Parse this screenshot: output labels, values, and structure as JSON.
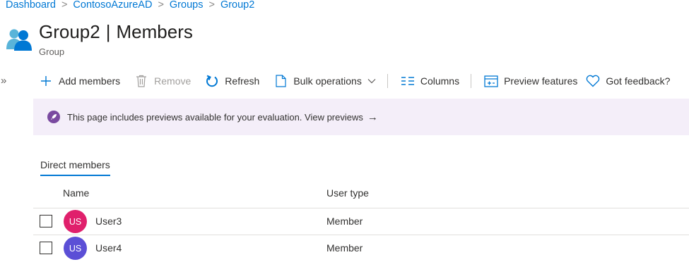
{
  "breadcrumb": [
    "Dashboard",
    "ContosoAzureAD",
    "Groups",
    "Group2"
  ],
  "header": {
    "name": "Group2",
    "section": "Members",
    "subtitle": "Group"
  },
  "collapse_glyph": "»",
  "toolbar": {
    "add": "Add members",
    "remove": "Remove",
    "refresh": "Refresh",
    "bulk": "Bulk operations",
    "columns": "Columns",
    "preview": "Preview features",
    "feedback": "Got feedback?"
  },
  "banner": {
    "text": "This page includes previews available for your evaluation. View previews",
    "arrow": "→"
  },
  "tab": "Direct members",
  "table": {
    "headers": [
      "Name",
      "User type"
    ],
    "rows": [
      {
        "initials": "US",
        "name": "User3",
        "type": "Member",
        "avatar_color": "#e0206c"
      },
      {
        "initials": "US",
        "name": "User4",
        "type": "Member",
        "avatar_color": "#5b4fd6"
      }
    ]
  },
  "colors": {
    "accent": "#0078d4",
    "banner_bg": "#f4eef9",
    "banner_icon": "#7a4aa0"
  },
  "icons": [
    "group-icon",
    "plus-icon",
    "trash-icon",
    "refresh-icon",
    "document-icon",
    "chevron-down-icon",
    "columns-icon",
    "preview-icon",
    "heart-icon",
    "rocket-icon",
    "arrow-right-icon"
  ]
}
